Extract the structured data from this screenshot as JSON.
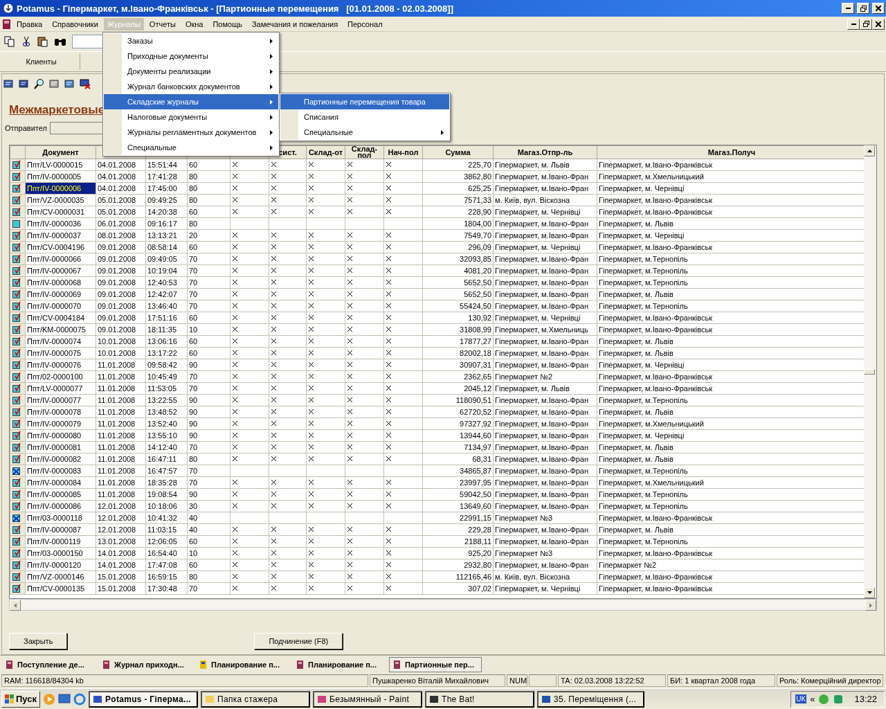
{
  "window": {
    "title": "Potamus - Гіпермаркет, м.Івано-Франківськ - [Партионные перемещения   [01.01.2008 - 02.03.2008]]"
  },
  "menu_bar": [
    {
      "label": "Правка",
      "selected": false
    },
    {
      "label": "Справочники",
      "selected": false
    },
    {
      "label": "Журналы",
      "selected": true
    },
    {
      "label": "Отчеты",
      "selected": false
    },
    {
      "label": "Окна",
      "selected": false
    },
    {
      "label": "Помощь",
      "selected": false
    },
    {
      "label": "Замечания и пожелания",
      "selected": false
    },
    {
      "label": "Персонал",
      "selected": false
    }
  ],
  "menu": [
    {
      "label": "Заказы",
      "selected": false,
      "submenu": true
    },
    {
      "label": "Приходные документы",
      "selected": false,
      "submenu": true
    },
    {
      "label": "Документы реализации",
      "selected": false,
      "submenu": true
    },
    {
      "label": "Журнал банковских документов",
      "selected": false,
      "submenu": true
    },
    {
      "label": "Складские журналы",
      "selected": true,
      "submenu": true
    },
    {
      "label": "Налоговые документы",
      "selected": false,
      "submenu": true
    },
    {
      "label": "Журналы регламентных документов",
      "selected": false,
      "submenu": true
    },
    {
      "label": "Специальные",
      "selected": false,
      "submenu": true
    }
  ],
  "submenu": [
    {
      "label": "Партионные перемещения товара",
      "selected": true,
      "submenu": false
    },
    {
      "label": "Списания",
      "selected": false,
      "submenu": false
    },
    {
      "label": "Специальные",
      "selected": false,
      "submenu": true
    }
  ],
  "tabs": [
    {
      "label": "Клиенты"
    }
  ],
  "heading": "Межмаркетовые",
  "sender_label": "Отправител",
  "table": {
    "columns": [
      "Документ",
      "",
      "",
      "",
      "",
      "сист.",
      "Склад-от",
      "Склад-пол",
      "Нач-пол",
      "Сумма",
      "Магаз.Отпр-ль",
      "Магаз.Получ"
    ],
    "rows": [
      {
        "kind": "posted",
        "selected": false,
        "document": "Ппт/LV-0000015",
        "date": "04.01.2008",
        "time": "15:51:44",
        "column_4": "60",
        "checks": [
          true,
          true,
          true,
          true,
          true
        ],
        "sum": "225,70",
        "sender": "Гіпермаркет, м. Львів",
        "receiver": "Гіпермаркет, м.Івано-Франківськ"
      },
      {
        "kind": "posted",
        "selected": false,
        "document": "Ппт/IV-0000005",
        "date": "04.01.2008",
        "time": "17:41:28",
        "column_4": "80",
        "checks": [
          true,
          true,
          true,
          true,
          true
        ],
        "sum": "3862,80",
        "sender": "Гіпермаркет, м.Івано-Фран",
        "receiver": "Гіпермаркет, м.Хмельницький"
      },
      {
        "kind": "posted",
        "selected": true,
        "document": "Ппт/IV-0000006",
        "date": "04.01.2008",
        "time": "17:45:00",
        "column_4": "80",
        "checks": [
          true,
          true,
          true,
          true,
          true
        ],
        "sum": "625,25",
        "sender": "Гіпермаркет, м.Івано-Фран",
        "receiver": "Гіпермаркет, м. Чернівці"
      },
      {
        "kind": "posted",
        "selected": false,
        "document": "Ппт/VZ-0000035",
        "date": "05.01.2008",
        "time": "09:49:25",
        "column_4": "80",
        "checks": [
          true,
          true,
          true,
          true,
          true
        ],
        "sum": "7571,33",
        "sender": "м. Київ, вул. Віскозна",
        "receiver": "Гіпермаркет, м.Івано-Франківськ"
      },
      {
        "kind": "posted",
        "selected": false,
        "document": "Ппт/CV-0000031",
        "date": "05.01.2008",
        "time": "14:20:38",
        "column_4": "60",
        "checks": [
          true,
          true,
          true,
          true,
          true
        ],
        "sum": "228,90",
        "sender": "Гіпермаркет, м. Чернівці",
        "receiver": "Гіпермаркет, м.Івано-Франківськ"
      },
      {
        "kind": "draft",
        "selected": false,
        "document": "Ппт/IV-0000036",
        "date": "06.01.2008",
        "time": "09:16:17",
        "column_4": "80",
        "checks": [
          false,
          false,
          false,
          false,
          false
        ],
        "sum": "1804,00",
        "sender": "Гіпермаркет, м.Івано-Фран",
        "receiver": "Гіпермаркет, м. Львів"
      },
      {
        "kind": "posted",
        "selected": false,
        "document": "Ппт/IV-0000037",
        "date": "08.01.2008",
        "time": "13:13:21",
        "column_4": "20",
        "checks": [
          true,
          true,
          true,
          true,
          true
        ],
        "sum": "7549,70",
        "sender": "Гіпермаркет, м.Івано-Фран",
        "receiver": "Гіпермаркет, м. Чернівці"
      },
      {
        "kind": "posted",
        "selected": false,
        "document": "Ппт/CV-0004196",
        "date": "09.01.2008",
        "time": "08:58:14",
        "column_4": "60",
        "checks": [
          true,
          true,
          true,
          true,
          true
        ],
        "sum": "296,09",
        "sender": "Гіпермаркет, м. Чернівці",
        "receiver": "Гіпермаркет, м.Івано-Франківськ"
      },
      {
        "kind": "posted",
        "selected": false,
        "document": "Ппт/IV-0000066",
        "date": "09.01.2008",
        "time": "09:49:05",
        "column_4": "70",
        "checks": [
          true,
          true,
          true,
          true,
          true
        ],
        "sum": "32093,85",
        "sender": "Гіпермаркет, м.Івано-Фран",
        "receiver": "Гіпермаркет, м.Тернопіль"
      },
      {
        "kind": "posted",
        "selected": false,
        "document": "Ппт/IV-0000067",
        "date": "09.01.2008",
        "time": "10:19:04",
        "column_4": "70",
        "checks": [
          true,
          true,
          true,
          true,
          true
        ],
        "sum": "4081,20",
        "sender": "Гіпермаркет, м.Івано-Фран",
        "receiver": "Гіпермаркет, м.Тернопіль"
      },
      {
        "kind": "posted",
        "selected": false,
        "document": "Ппт/IV-0000068",
        "date": "09.01.2008",
        "time": "12:40:53",
        "column_4": "70",
        "checks": [
          true,
          true,
          true,
          true,
          true
        ],
        "sum": "5652,50",
        "sender": "Гіпермаркет, м.Івано-Фран",
        "receiver": "Гіпермаркет, м.Тернопіль"
      },
      {
        "kind": "posted",
        "selected": false,
        "document": "Ппт/IV-0000069",
        "date": "09.01.2008",
        "time": "12:42:07",
        "column_4": "70",
        "checks": [
          true,
          true,
          true,
          true,
          true
        ],
        "sum": "5652,50",
        "sender": "Гіпермаркет, м.Івано-Фран",
        "receiver": "Гіпермаркет, м. Львів"
      },
      {
        "kind": "posted",
        "selected": false,
        "document": "Ппт/IV-0000070",
        "date": "09.01.2008",
        "time": "13:46:40",
        "column_4": "70",
        "checks": [
          true,
          true,
          true,
          true,
          true
        ],
        "sum": "55424,50",
        "sender": "Гіпермаркет, м.Івано-Фран",
        "receiver": "Гіпермаркет, м.Тернопіль"
      },
      {
        "kind": "posted",
        "selected": false,
        "document": "Ппт/CV-0004184",
        "date": "09.01.2008",
        "time": "17:51:16",
        "column_4": "60",
        "checks": [
          true,
          true,
          true,
          true,
          true
        ],
        "sum": "130,92",
        "sender": "Гіпермаркет, м. Чернівці",
        "receiver": "Гіпермаркет, м.Івано-Франківськ"
      },
      {
        "kind": "posted",
        "selected": false,
        "document": "Ппт/KM-0000075",
        "date": "09.01.2008",
        "time": "18:11:35",
        "column_4": "10",
        "checks": [
          true,
          true,
          true,
          true,
          true
        ],
        "sum": "31808,99",
        "sender": "Гіпермаркет, м.Хмельниць",
        "receiver": "Гіпермаркет, м.Івано-Франківськ"
      },
      {
        "kind": "posted",
        "selected": false,
        "document": "Ппт/IV-0000074",
        "date": "10.01.2008",
        "time": "13:06:16",
        "column_4": "60",
        "checks": [
          true,
          true,
          true,
          true,
          true
        ],
        "sum": "17877,27",
        "sender": "Гіпермаркет, м.Івано-Фран",
        "receiver": "Гіпермаркет, м. Львів"
      },
      {
        "kind": "posted",
        "selected": false,
        "document": "Ппт/IV-0000075",
        "date": "10.01.2008",
        "time": "13:17:22",
        "column_4": "60",
        "checks": [
          true,
          true,
          true,
          true,
          true
        ],
        "sum": "82002,18",
        "sender": "Гіпермаркет, м.Івано-Фран",
        "receiver": "Гіпермаркет, м. Львів"
      },
      {
        "kind": "posted",
        "selected": false,
        "document": "Ппт/IV-0000076",
        "date": "11.01.2008",
        "time": "09:58:42",
        "column_4": "90",
        "checks": [
          true,
          true,
          true,
          true,
          true
        ],
        "sum": "30907,31",
        "sender": "Гіпермаркет, м.Івано-Фран",
        "receiver": "Гіпермаркет, м. Чернівці"
      },
      {
        "kind": "posted",
        "selected": false,
        "document": "Ппт/02-0000100",
        "date": "11.01.2008",
        "time": "10:45:49",
        "column_4": "70",
        "checks": [
          true,
          true,
          true,
          true,
          true
        ],
        "sum": "2362,65",
        "sender": "Гіпермаркет №2",
        "receiver": "Гіпермаркет, м.Івано-Франківськ"
      },
      {
        "kind": "posted",
        "selected": false,
        "document": "Ппт/LV-0000077",
        "date": "11.01.2008",
        "time": "11:53:05",
        "column_4": "70",
        "checks": [
          true,
          true,
          true,
          true,
          true
        ],
        "sum": "2045,12",
        "sender": "Гіпермаркет, м. Львів",
        "receiver": "Гіпермаркет, м.Івано-Франківськ"
      },
      {
        "kind": "posted",
        "selected": false,
        "document": "Ппт/IV-0000077",
        "date": "11.01.2008",
        "time": "13:22:55",
        "column_4": "90",
        "checks": [
          true,
          true,
          true,
          true,
          true
        ],
        "sum": "118090,51",
        "sender": "Гіпермаркет, м.Івано-Фран",
        "receiver": "Гіпермаркет, м.Тернопіль"
      },
      {
        "kind": "posted",
        "selected": false,
        "document": "Ппт/IV-0000078",
        "date": "11.01.2008",
        "time": "13:48:52",
        "column_4": "90",
        "checks": [
          true,
          true,
          true,
          true,
          true
        ],
        "sum": "62720,52",
        "sender": "Гіпермаркет, м.Івано-Фран",
        "receiver": "Гіпермаркет, м. Львів"
      },
      {
        "kind": "posted",
        "selected": false,
        "document": "Ппт/IV-0000079",
        "date": "11.01.2008",
        "time": "13:52:40",
        "column_4": "90",
        "checks": [
          true,
          true,
          true,
          true,
          true
        ],
        "sum": "97327,92",
        "sender": "Гіпермаркет, м.Івано-Фран",
        "receiver": "Гіпермаркет, м.Хмельницький"
      },
      {
        "kind": "posted",
        "selected": false,
        "document": "Ппт/IV-0000080",
        "date": "11.01.2008",
        "time": "13:55:10",
        "column_4": "90",
        "checks": [
          true,
          true,
          true,
          true,
          true
        ],
        "sum": "13944,60",
        "sender": "Гіпермаркет, м.Івано-Фран",
        "receiver": "Гіпермаркет, м. Чернівці"
      },
      {
        "kind": "posted",
        "selected": false,
        "document": "Ппт/IV-0000081",
        "date": "11.01.2008",
        "time": "14:12:40",
        "column_4": "70",
        "checks": [
          true,
          true,
          true,
          true,
          true
        ],
        "sum": "7134,97",
        "sender": "Гіпермаркет, м.Івано-Фран",
        "receiver": "Гіпермаркет, м. Львів"
      },
      {
        "kind": "posted",
        "selected": false,
        "document": "Ппт/IV-0000082",
        "date": "11.01.2008",
        "time": "16:47:11",
        "column_4": "80",
        "checks": [
          true,
          true,
          true,
          true,
          true
        ],
        "sum": "68,31",
        "sender": "Гіпермаркет, м.Івано-Фран",
        "receiver": "Гіпермаркет, м. Львів"
      },
      {
        "kind": "deleted",
        "selected": false,
        "document": "Ппт/IV-0000083",
        "date": "11.01.2008",
        "time": "16:47:57",
        "column_4": "70",
        "checks": [
          false,
          false,
          false,
          false,
          false
        ],
        "sum": "34865,87",
        "sender": "Гіпермаркет, м.Івано-Фран",
        "receiver": "Гіпермаркет, м.Тернопіль"
      },
      {
        "kind": "posted",
        "selected": false,
        "document": "Ппт/IV-0000084",
        "date": "11.01.2008",
        "time": "18:35:28",
        "column_4": "70",
        "checks": [
          true,
          true,
          true,
          true,
          true
        ],
        "sum": "23997,95",
        "sender": "Гіпермаркет, м.Івано-Фран",
        "receiver": "Гіпермаркет, м.Хмельницький"
      },
      {
        "kind": "posted",
        "selected": false,
        "document": "Ппт/IV-0000085",
        "date": "11.01.2008",
        "time": "19:08:54",
        "column_4": "90",
        "checks": [
          true,
          true,
          true,
          true,
          true
        ],
        "sum": "59042,50",
        "sender": "Гіпермаркет, м.Івано-Фран",
        "receiver": "Гіпермаркет, м.Тернопіль"
      },
      {
        "kind": "posted",
        "selected": false,
        "document": "Ппт/IV-0000086",
        "date": "12.01.2008",
        "time": "10:18:06",
        "column_4": "30",
        "checks": [
          true,
          true,
          true,
          true,
          true
        ],
        "sum": "13649,60",
        "sender": "Гіпермаркет, м.Івано-Фран",
        "receiver": "Гіпермаркет, м.Тернопіль"
      },
      {
        "kind": "deleted",
        "selected": false,
        "document": "Ппт/03-0000118",
        "date": "12.01.2008",
        "time": "10:41:32",
        "column_4": "40",
        "checks": [
          false,
          false,
          false,
          false,
          false
        ],
        "sum": "22991,15",
        "sender": "Гіпермаркет №3",
        "receiver": "Гіпермаркет, м.Івано-Франківськ"
      },
      {
        "kind": "posted",
        "selected": false,
        "document": "Ппт/IV-0000087",
        "date": "12.01.2008",
        "time": "11:03:15",
        "column_4": "40",
        "checks": [
          true,
          true,
          true,
          true,
          true
        ],
        "sum": "229,28",
        "sender": "Гіпермаркет, м.Івано-Фран",
        "receiver": "Гіпермаркет, м. Львів"
      },
      {
        "kind": "posted",
        "selected": false,
        "document": "Ппт/IV-0000119",
        "date": "13.01.2008",
        "time": "12:06:05",
        "column_4": "60",
        "checks": [
          true,
          true,
          true,
          true,
          true
        ],
        "sum": "2188,11",
        "sender": "Гіпермаркет, м.Івано-Фран",
        "receiver": "Гіпермаркет, м.Тернопіль"
      },
      {
        "kind": "posted",
        "selected": false,
        "document": "Ппт/03-0000150",
        "date": "14.01.2008",
        "time": "16:54:40",
        "column_4": "10",
        "checks": [
          true,
          true,
          true,
          true,
          true
        ],
        "sum": "925,20",
        "sender": "Гіпермаркет №3",
        "receiver": "Гіпермаркет, м.Івано-Франківськ"
      },
      {
        "kind": "posted",
        "selected": false,
        "document": "Ппт/IV-0000120",
        "date": "14.01.2008",
        "time": "17:47:08",
        "column_4": "60",
        "checks": [
          true,
          true,
          true,
          true,
          true
        ],
        "sum": "2932,80",
        "sender": "Гіпермаркет, м.Івано-Фран",
        "receiver": "Гіпермаркет №2"
      },
      {
        "kind": "posted",
        "selected": false,
        "document": "Ппт/VZ-0000146",
        "date": "15.01.2008",
        "time": "16:59:15",
        "column_4": "80",
        "checks": [
          true,
          true,
          true,
          true,
          true
        ],
        "sum": "112165,46",
        "sender": "м. Київ, вул. Віскозна",
        "receiver": "Гіпермаркет, м.Івано-Франківськ"
      },
      {
        "kind": "posted",
        "selected": false,
        "document": "Ппт/CV-0000135",
        "date": "15.01.2008",
        "time": "17:30:48",
        "column_4": "70",
        "checks": [
          true,
          true,
          true,
          true,
          true
        ],
        "sum": "307,02",
        "sender": "Гіпермаркет, м. Чернівці",
        "receiver": "Гіпермаркет, м.Івано-Франківськ"
      }
    ]
  },
  "buttons": [
    "Закрыть",
    "Подчинение (F8)"
  ],
  "window_tabs": [
    {
      "label": "Поступление де...",
      "selected": false
    },
    {
      "label": "Журнал приходн...",
      "selected": false
    },
    {
      "label": "Планирование п...",
      "selected": false
    },
    {
      "label": "Планирование п...",
      "selected": false
    },
    {
      "label": "Партионные пер...",
      "selected": true
    }
  ],
  "status_bar": [
    "RAM: 116618/84304 kb",
    "Пушкаренко Віталій Михайлович",
    "NUM",
    "ТА: 02.03.2008 13:22:52",
    "БИ: 1 квартал 2008 года",
    "Роль: Комерційний директор"
  ],
  "taskbar": {
    "start": "Пуск",
    "tasks": [
      {
        "label": "Potamus - Гіперма...",
        "selected": true
      },
      {
        "label": "Папка стажера",
        "selected": false
      },
      {
        "label": "Безымянный - Paint",
        "selected": false
      },
      {
        "label": "The Bat!",
        "selected": false
      },
      {
        "label": "35. Переміщення (...",
        "selected": false
      }
    ],
    "language": "UK",
    "tray_toggle": "«",
    "clock": "13:22"
  }
}
